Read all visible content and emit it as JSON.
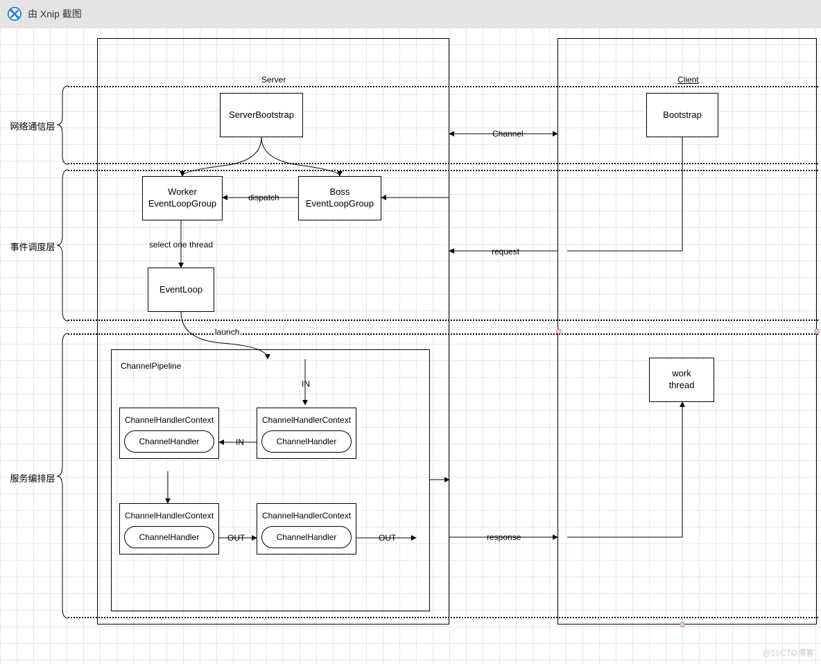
{
  "titlebar": {
    "text": "由 Xnip 截图"
  },
  "watermark": "@51CTO博客",
  "containers": {
    "server": "Server",
    "client": "Client",
    "pipeline": "ChannelPipeline"
  },
  "layers": {
    "net": "网络通信层",
    "sched": "事件调度层",
    "service": "服务编排层"
  },
  "boxes": {
    "serverBootstrap": "ServerBootstrap",
    "bootstrap": "Bootstrap",
    "workerELG": "Worker\nEventLoopGroup",
    "bossELG": "Boss\nEventLoopGroup",
    "eventLoop": "EventLoop",
    "workThread": "work\nthread"
  },
  "chc": {
    "title": "ChannelHandlerContext",
    "inner": "ChannelHandler"
  },
  "edgeLabels": {
    "channel": "Channel",
    "dispatch": "dispatch",
    "selectOne": "select one thread",
    "launch": "launch",
    "in": "IN",
    "out": "OUT",
    "request": "request",
    "response": "response"
  }
}
